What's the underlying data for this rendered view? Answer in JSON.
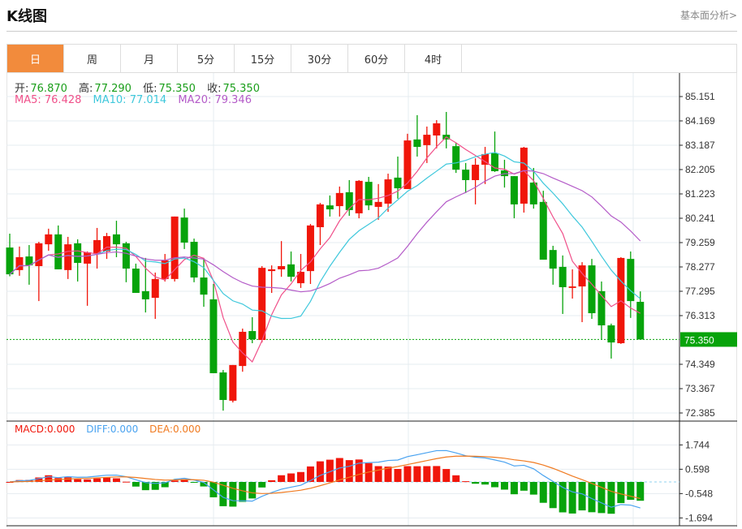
{
  "header": {
    "title": "K线图",
    "link": "基本面分析>"
  },
  "tabs": [
    {
      "label": "日",
      "active": true
    },
    {
      "label": "周"
    },
    {
      "label": "月"
    },
    {
      "label": "5分"
    },
    {
      "label": "15分"
    },
    {
      "label": "30分"
    },
    {
      "label": "60分"
    },
    {
      "label": "4时"
    }
  ],
  "info": {
    "open_label": "开:",
    "open": "76.870",
    "high_label": "高:",
    "high": "77.290",
    "low_label": "低:",
    "low": "75.350",
    "close_label": "收:",
    "close": "75.350",
    "ma5": "MA5: 76.428",
    "ma10": "MA10: 77.014",
    "ma20": "MA20: 79.346"
  },
  "macd_info": {
    "macd": "MACD:0.000",
    "diff": "DIFF:0.000",
    "dea": "DEA:0.000"
  },
  "colors": {
    "up": "#f0160a",
    "down": "#07a30b",
    "ma5": "#f0508a",
    "ma10": "#3fc8dc",
    "ma20": "#b45bc8",
    "diff": "#4aa3f0",
    "dea": "#f07a20",
    "accent": "#f28b3c"
  },
  "chart_data": [
    {
      "type": "candlestick",
      "title": "K线图",
      "columns": [
        "open",
        "close",
        "high",
        "low"
      ],
      "candles": [
        [
          79.06,
          77.98,
          79.62,
          77.9
        ],
        [
          78.15,
          78.67,
          79.1,
          77.92
        ],
        [
          78.7,
          78.34,
          79.16,
          77.56
        ],
        [
          78.31,
          79.23,
          79.29,
          76.9
        ],
        [
          79.19,
          79.59,
          79.82,
          78.93
        ],
        [
          79.59,
          78.18,
          79.95,
          78.18
        ],
        [
          78.15,
          79.19,
          79.49,
          77.79
        ],
        [
          79.23,
          78.44,
          79.39,
          77.69
        ],
        [
          78.41,
          78.87,
          78.9,
          76.71
        ],
        [
          78.8,
          79.36,
          79.85,
          78.21
        ],
        [
          78.9,
          79.52,
          79.65,
          78.6
        ],
        [
          79.59,
          79.19,
          80.14,
          78.67
        ],
        [
          79.23,
          78.21,
          79.29,
          77.66
        ],
        [
          78.21,
          77.23,
          78.41,
          77.23
        ],
        [
          77.3,
          76.97,
          78.64,
          76.44
        ],
        [
          77.03,
          77.79,
          78.05,
          76.18
        ],
        [
          77.79,
          78.54,
          78.8,
          77.69
        ],
        [
          77.79,
          80.31,
          80.31,
          77.69
        ],
        [
          80.27,
          79.26,
          80.63,
          79.0
        ],
        [
          79.29,
          77.85,
          79.42,
          77.66
        ],
        [
          77.85,
          77.16,
          78.64,
          76.67
        ],
        [
          76.97,
          73.99,
          77.59,
          73.99
        ],
        [
          74.02,
          72.91,
          74.12,
          72.48
        ],
        [
          72.88,
          74.32,
          74.32,
          72.81
        ],
        [
          74.28,
          75.66,
          75.79,
          74.05
        ],
        [
          75.69,
          75.36,
          76.25,
          75.2
        ],
        [
          75.33,
          78.24,
          78.31,
          75.23
        ],
        [
          78.11,
          78.18,
          78.34,
          77.23
        ],
        [
          78.18,
          78.31,
          79.32,
          77.88
        ],
        [
          78.38,
          77.88,
          78.9,
          77.69
        ],
        [
          77.62,
          78.08,
          78.8,
          77.43
        ],
        [
          78.11,
          79.95,
          80.01,
          77.59
        ],
        [
          79.88,
          80.8,
          80.86,
          79.16
        ],
        [
          80.76,
          80.6,
          81.16,
          80.31
        ],
        [
          80.73,
          81.26,
          81.52,
          80.31
        ],
        [
          81.29,
          80.57,
          81.78,
          80.34
        ],
        [
          80.44,
          81.75,
          81.78,
          80.24
        ],
        [
          81.71,
          80.76,
          81.91,
          80.57
        ],
        [
          80.7,
          80.9,
          81.62,
          80.18
        ],
        [
          80.83,
          81.81,
          82.04,
          80.5
        ],
        [
          81.88,
          81.45,
          82.73,
          81.03
        ],
        [
          81.42,
          83.38,
          83.65,
          81.42
        ],
        [
          83.42,
          83.12,
          84.4,
          82.73
        ],
        [
          83.19,
          83.61,
          83.94,
          82.47
        ],
        [
          83.58,
          84.07,
          84.2,
          83.06
        ],
        [
          83.61,
          83.42,
          84.53,
          83.06
        ],
        [
          83.15,
          82.2,
          83.29,
          82.07
        ],
        [
          82.2,
          81.78,
          82.47,
          81.26
        ],
        [
          81.78,
          82.4,
          82.66,
          80.8
        ],
        [
          82.4,
          82.83,
          83.12,
          81.62
        ],
        [
          82.86,
          82.14,
          83.74,
          82.11
        ],
        [
          82.17,
          81.94,
          82.6,
          81.48
        ],
        [
          81.94,
          80.8,
          81.94,
          80.24
        ],
        [
          80.83,
          83.09,
          83.12,
          80.47
        ],
        [
          81.68,
          80.8,
          82.27,
          80.63
        ],
        [
          80.9,
          78.57,
          81.35,
          78.57
        ],
        [
          78.96,
          78.21,
          79.13,
          77.56
        ],
        [
          78.28,
          77.46,
          78.74,
          76.38
        ],
        [
          77.43,
          77.49,
          78.18,
          77.0
        ],
        [
          77.49,
          78.34,
          78.47,
          76.05
        ],
        [
          78.34,
          76.41,
          78.6,
          76.18
        ],
        [
          77.3,
          75.92,
          77.69,
          75.36
        ],
        [
          75.92,
          75.23,
          75.99,
          74.58
        ],
        [
          75.2,
          78.64,
          78.67,
          75.17
        ],
        [
          78.6,
          76.9,
          78.9,
          76.22
        ],
        [
          76.87,
          75.35,
          77.29,
          75.35
        ]
      ],
      "moving_averages": [
        "MA5",
        "MA10",
        "MA20"
      ],
      "ylim": [
        72.385,
        85.151
      ],
      "yticks": [
        "85.151",
        "84.169",
        "83.187",
        "82.205",
        "81.223",
        "80.241",
        "79.259",
        "78.277",
        "77.295",
        "76.313",
        "74.349",
        "73.367",
        "72.385"
      ],
      "last_price": "75.350",
      "grid": true
    },
    {
      "type": "macd",
      "series": [
        "MACD",
        "DIFF",
        "DEA"
      ],
      "ylim": [
        -1.694,
        1.744
      ],
      "yticks": [
        "1.744",
        "0.598",
        "-0.548",
        "-1.694"
      ]
    }
  ]
}
